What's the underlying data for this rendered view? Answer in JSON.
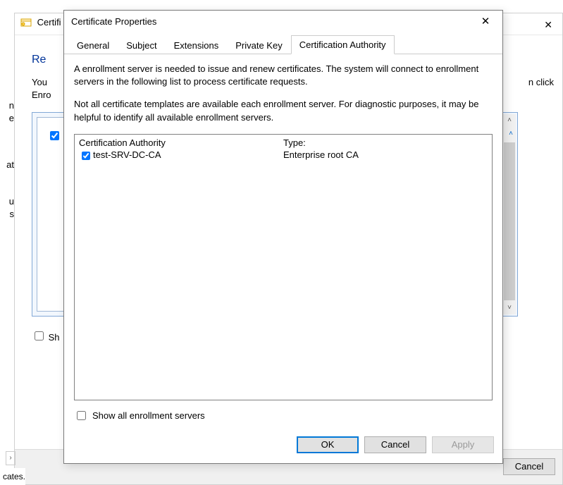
{
  "bg_window": {
    "title_fragment": "Certifi",
    "h1_fragment": "Re",
    "body_fragment": "You",
    "body_fragment2": "Enro",
    "right_text_tail": "n click",
    "show_cb_fragment": "Sh",
    "cancel_btn": "Cancel",
    "status_fragment": "cates."
  },
  "left_fragments": {
    "f1": "n",
    "f2": "e",
    "f3": "at",
    "f4": "u",
    "f5": "s"
  },
  "dialog": {
    "title": "Certificate Properties",
    "tabs": {
      "t1": "General",
      "t2": "Subject",
      "t3": "Extensions",
      "t4": "Private Key",
      "t5": "Certification Authority"
    },
    "desc_p1": "A enrollment server is needed to issue and renew certificates. The system will connect to enrollment servers in the following list to process certificate requests.",
    "desc_p2": "Not all certificate templates are available each enrollment server. For diagnostic purposes, it may be helpful to identify all available enrollment servers.",
    "ca_list": {
      "col1_header": "Certification Authority",
      "col2_header": "Type:",
      "row1_name": "test-SRV-DC-CA",
      "row1_type": "Enterprise root CA"
    },
    "show_all_label": "Show all enrollment servers",
    "buttons": {
      "ok": "OK",
      "cancel": "Cancel",
      "apply": "Apply"
    }
  }
}
